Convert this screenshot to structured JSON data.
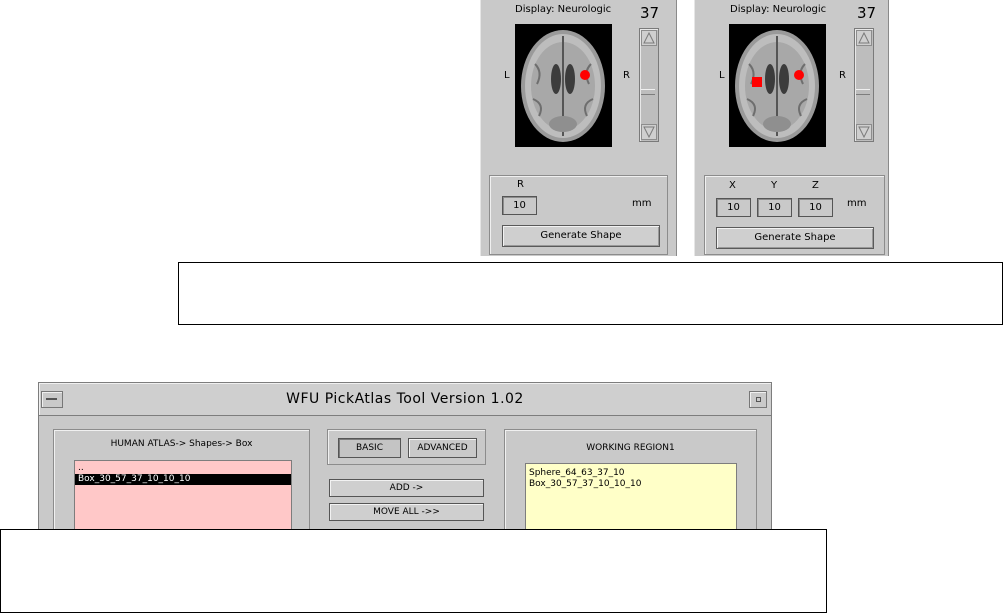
{
  "panels": [
    {
      "display_label": "Display: Neurologic",
      "slice_number": "37",
      "left_label": "L",
      "right_label": "R",
      "fields": [
        {
          "label": "R",
          "value": "10"
        }
      ],
      "units": "mm",
      "generate_label": "Generate Shape"
    },
    {
      "display_label": "Display: Neurologic",
      "slice_number": "37",
      "left_label": "L",
      "right_label": "R",
      "fields": [
        {
          "label": "X",
          "value": "10"
        },
        {
          "label": "Y",
          "value": "10"
        },
        {
          "label": "Z",
          "value": "10"
        }
      ],
      "units": "mm",
      "generate_label": "Generate Shape"
    }
  ],
  "colors": {
    "marker": "#ff0000",
    "region_list_bg": "#ffffc8",
    "atlas_list_bg": "#ffc8c8"
  },
  "pickatlas": {
    "title": "WFU PickAtlas Tool   Version 1.02",
    "atlas_group": {
      "title": "HUMAN ATLAS-> Shapes-> Box",
      "items": [
        "..",
        "Box_30_57_37_10_10_10"
      ],
      "selected_index": 1
    },
    "mode": {
      "basic_label": "BASIC",
      "advanced_label": "ADVANCED",
      "active": "basic"
    },
    "add_label": "ADD ->",
    "move_all_label": "MOVE ALL ->>",
    "region_group": {
      "title": "WORKING REGION1",
      "items": [
        "Sphere_64_63_37_10",
        "Box_30_57_37_10_10_10"
      ]
    }
  }
}
